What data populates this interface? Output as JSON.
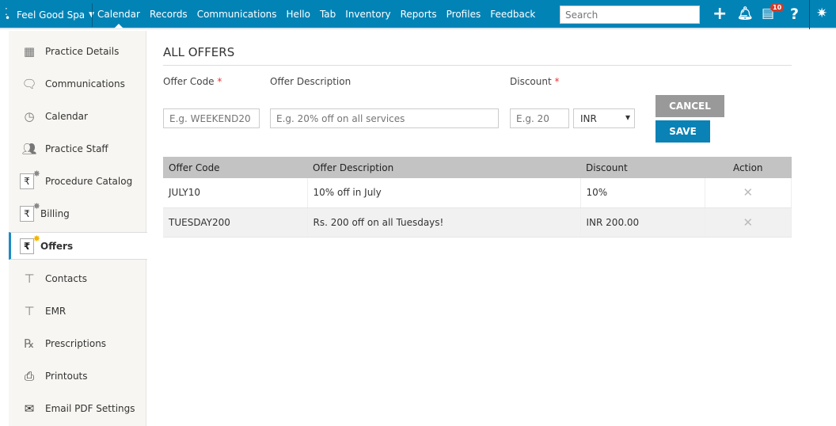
{
  "topbar": {
    "brand": "Feel Good Spa",
    "nav": [
      "Calendar",
      "Records",
      "Communications",
      "Hello",
      "Tab",
      "Inventory",
      "Reports",
      "Profiles",
      "Feedback"
    ],
    "active": "Calendar",
    "search_placeholder": "Search",
    "notification_count": "10"
  },
  "sidebar": {
    "items": [
      {
        "label": "Practice Details",
        "icon": "building-icon"
      },
      {
        "label": "Communications",
        "icon": "speech-bubble-icon"
      },
      {
        "label": "Calendar",
        "icon": "calendar-clock-icon"
      },
      {
        "label": "Practice Staff",
        "icon": "people-icon"
      },
      {
        "label": "Procedure Catalog",
        "icon": "rupee-icon"
      },
      {
        "label": "Billing",
        "icon": "rupee-icon"
      },
      {
        "label": "Offers",
        "icon": "rupee-star-icon"
      },
      {
        "label": "Contacts",
        "icon": "contact-icon"
      },
      {
        "label": "EMR",
        "icon": "emr-icon"
      },
      {
        "label": "Prescriptions",
        "icon": "rx-icon"
      },
      {
        "label": "Printouts",
        "icon": "printer-icon"
      },
      {
        "label": "Email PDF Settings",
        "icon": "email-pdf-icon"
      }
    ],
    "active": "Offers"
  },
  "page": {
    "title": "ALL OFFERS"
  },
  "form": {
    "offer_code_label": "Offer Code",
    "offer_code_placeholder": "E.g. WEEKEND20",
    "desc_label": "Offer Description",
    "desc_placeholder": "E.g. 20% off on all services",
    "discount_label": "Discount",
    "discount_placeholder": "E.g. 20",
    "currency": "INR",
    "required_mark": "*",
    "cancel": "CANCEL",
    "save": "SAVE"
  },
  "table": {
    "headers": [
      "Offer Code",
      "Offer Description",
      "Discount",
      "Action"
    ],
    "rows": [
      {
        "code": "JULY10",
        "desc": "10% off in July",
        "discount": "10%"
      },
      {
        "code": "TUESDAY200",
        "desc": "Rs. 200 off on all Tuesdays!",
        "discount": "INR 200.00"
      }
    ],
    "delete_glyph": "✕"
  },
  "colors": {
    "topbar": "#0283b6",
    "save": "#0a82b5",
    "cancel": "#999999"
  }
}
